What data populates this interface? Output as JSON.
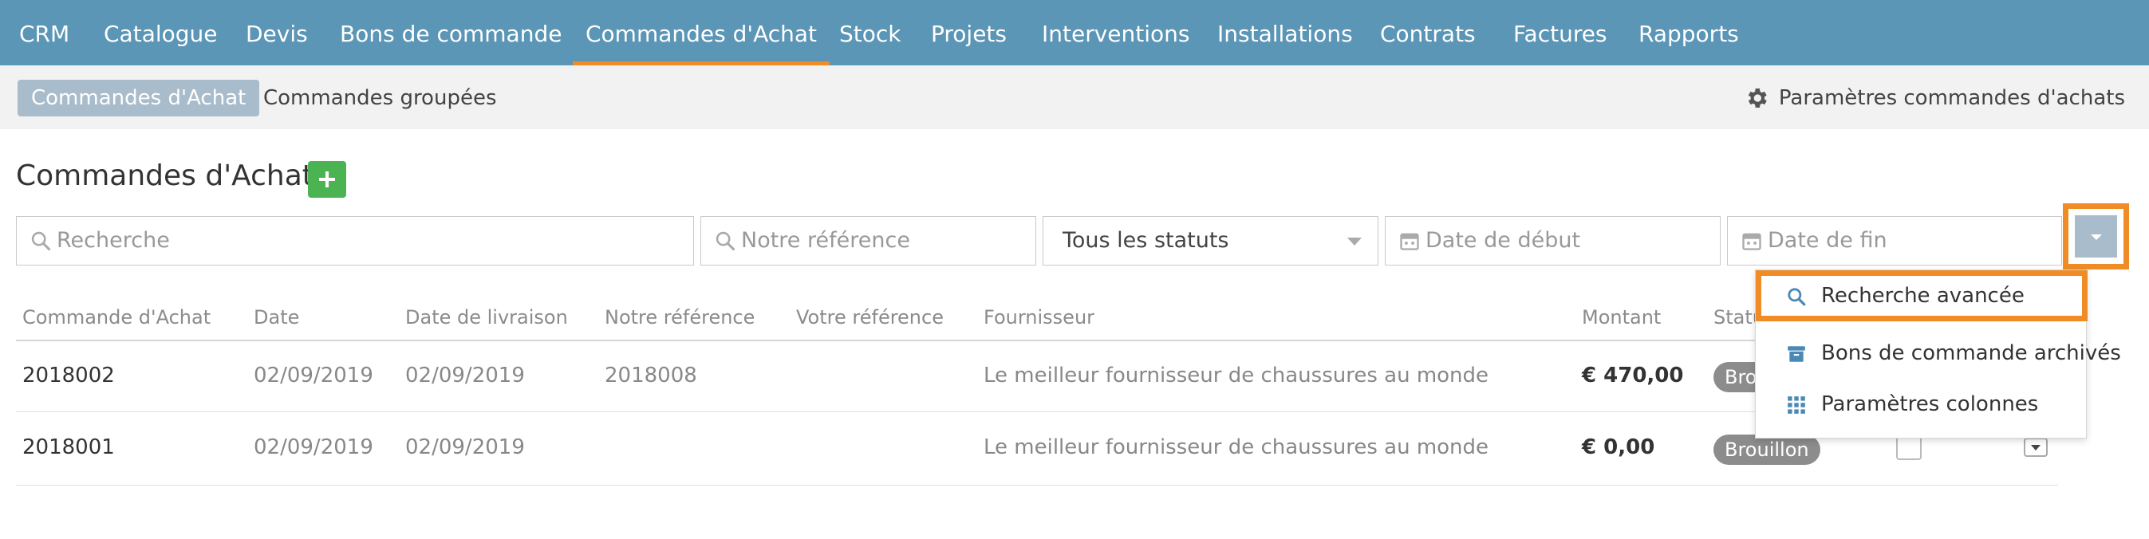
{
  "topnav": {
    "items": [
      "CRM",
      "Catalogue",
      "Devis",
      "Bons de commande",
      "Commandes d'Achat",
      "Stock",
      "Projets",
      "Interventions",
      "Installations",
      "Contrats",
      "Factures",
      "Rapports"
    ],
    "active": "Commandes d'Achat"
  },
  "subnav": {
    "tabs": [
      "Commandes d'Achat",
      "Commandes groupées"
    ],
    "settings_label": "Paramètres commandes d'achats"
  },
  "page": {
    "title": "Commandes d'Achat"
  },
  "filters": {
    "search_placeholder": "Recherche",
    "reference_placeholder": "Notre référence",
    "status_value": "Tous les statuts",
    "start_date_placeholder": "Date de début",
    "end_date_placeholder": "Date de fin"
  },
  "table": {
    "headers": [
      "Commande d'Achat",
      "Date",
      "Date de livraison",
      "Notre référence",
      "Votre référence",
      "Fournisseur",
      "Montant",
      "Statut"
    ],
    "rows": [
      {
        "order": "2018002",
        "date": "02/09/2019",
        "delivery": "02/09/2019",
        "our_ref": "2018008",
        "your_ref": "",
        "supplier": "Le meilleur fournisseur de chaussures au monde",
        "amount": "€ 470,00",
        "status": "Brouillon"
      },
      {
        "order": "2018001",
        "date": "02/09/2019",
        "delivery": "02/09/2019",
        "our_ref": "",
        "your_ref": "",
        "supplier": "Le meilleur fournisseur de chaussures au monde",
        "amount": "€ 0,00",
        "status": "Brouillon"
      }
    ]
  },
  "dropdown_menu": {
    "items": [
      "Recherche avancée",
      "Bons de commande archivés",
      "Paramètres colonnes"
    ]
  },
  "colors": {
    "nav_bg": "#5b96b7",
    "active_underline": "#f08c25",
    "highlight": "#f08c25",
    "add_button": "#4cb352",
    "pill": "#a9bccb",
    "badge": "#8c8c8c",
    "icon_blue": "#4a89b5"
  },
  "icons": [
    "gear-icon",
    "plus-icon",
    "search-icon",
    "calendar-icon",
    "caret-down-icon",
    "archive-icon",
    "grid-icon"
  ]
}
